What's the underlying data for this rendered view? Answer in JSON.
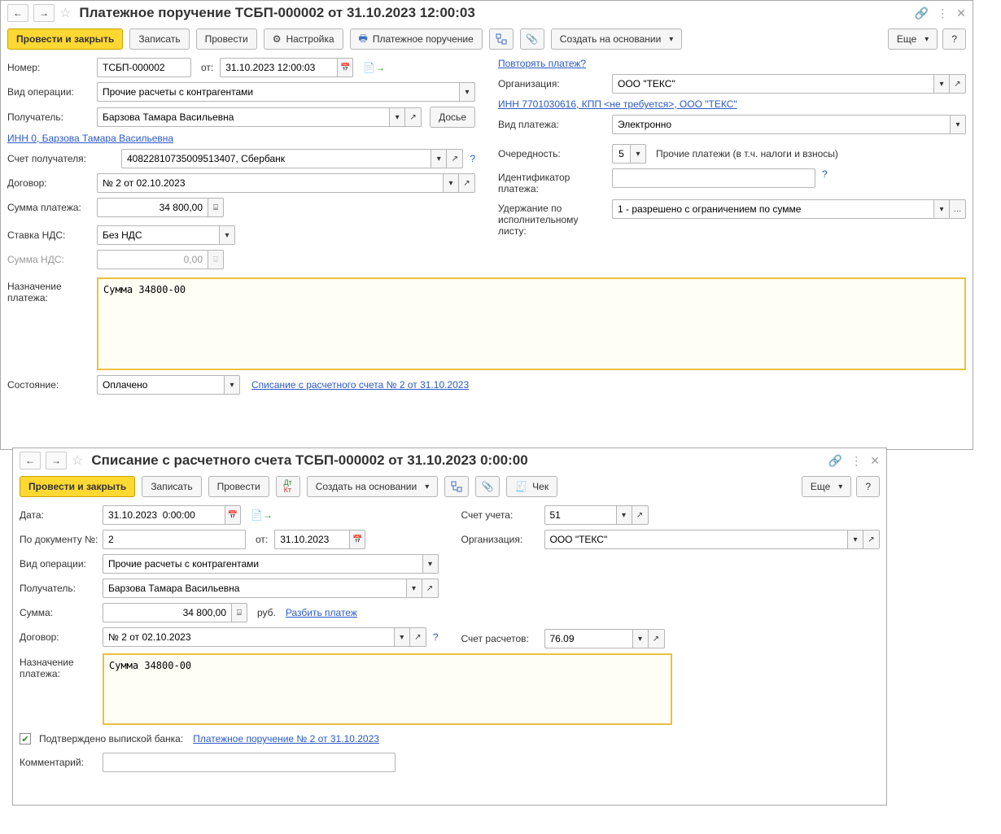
{
  "win1": {
    "title": "Платежное поручение ТСБП-000002 от 31.10.2023 12:00:03",
    "toolbar": {
      "post_close": "Провести и закрыть",
      "write": "Записать",
      "post": "Провести",
      "settings": "Настройка",
      "print_po": "Платежное поручение",
      "create_based": "Создать на основании",
      "more": "Еще",
      "help": "?"
    },
    "labels": {
      "number": "Номер:",
      "from": "от:",
      "repeat_link": "Повторять платеж?",
      "op_type": "Вид операции:",
      "org": "Организация:",
      "payee": "Получатель:",
      "dossier": "Досье",
      "inn_link": "ИНН 0, Барзова Тамара Васильевна",
      "org_inn_link": "ИНН 7701030616, КПП <не требуется>, ООО \"ТЕКС\"",
      "payment_type": "Вид платежа:",
      "payee_account": "Счет получателя:",
      "priority": "Очередность:",
      "priority_text": "Прочие платежи (в т.ч. налоги и взносы)",
      "contract": "Договор:",
      "payment_id": "Идентификатор платежа:",
      "amount": "Сумма платежа:",
      "withholding": "Удержание по исполнительному листу:",
      "vat_rate": "Ставка НДС:",
      "vat_sum": "Сумма НДС:",
      "purpose": "Назначение платежа:",
      "state": "Состояние:",
      "state_link": "Списание с расчетного счета № 2 от 31.10.2023"
    },
    "values": {
      "number": "ТСБП-000002",
      "date": "31.10.2023 12:00:03",
      "op_type": "Прочие расчеты с контрагентами",
      "org": "ООО \"ТЕКС\"",
      "payee": "Барзова Тамара Васильевна",
      "payment_type": "Электронно",
      "payee_account": "40822810735009513407, Сбербанк",
      "priority": "5",
      "contract": "№ 2 от 02.10.2023",
      "amount": "34 800,00",
      "withholding": "1 - разрешено с ограничением по сумме",
      "vat_rate": "Без НДС",
      "vat_sum": "0,00",
      "purpose": "Сумма 34800-00",
      "state": "Оплачено"
    }
  },
  "win2": {
    "title": "Списание с расчетного счета ТСБП-000002 от 31.10.2023 0:00:00",
    "toolbar": {
      "post_close": "Провести и закрыть",
      "write": "Записать",
      "post": "Провести",
      "create_based": "Создать на основании",
      "cheque": "Чек",
      "more": "Еще",
      "help": "?"
    },
    "labels": {
      "date": "Дата:",
      "account": "Счет учета:",
      "doc_no": "По документу №:",
      "from": "от:",
      "org": "Организация:",
      "op_type": "Вид операции:",
      "payee": "Получатель:",
      "amount": "Сумма:",
      "rub": "руб.",
      "split_link": "Разбить платеж",
      "contract": "Договор:",
      "settlement_account": "Счет расчетов:",
      "purpose": "Назначение платежа:",
      "confirmed": "Подтверждено выпиской банка:",
      "po_link": "Платежное поручение № 2 от 31.10.2023",
      "comment": "Комментарий:"
    },
    "values": {
      "date": "31.10.2023  0:00:00",
      "account": "51",
      "doc_no": "2",
      "doc_date": "31.10.2023",
      "org": "ООО \"ТЕКС\"",
      "op_type": "Прочие расчеты с контрагентами",
      "payee": "Барзова Тамара Васильевна",
      "amount": "34 800,00",
      "contract": "№ 2 от 02.10.2023",
      "settlement_account": "76.09",
      "purpose": "Сумма 34800-00"
    }
  }
}
